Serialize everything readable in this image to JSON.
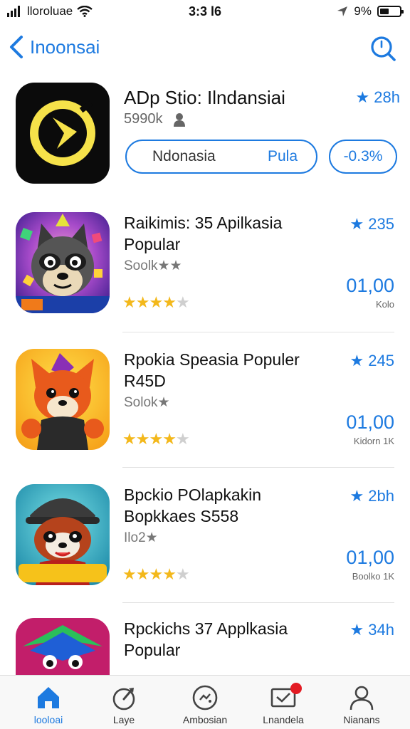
{
  "status_bar": {
    "carrier": "lloroluae",
    "time": "3:3 l6",
    "battery_text": "9%"
  },
  "nav": {
    "back_label": "Inoonsai",
    "search_icon": "search-icon"
  },
  "featured": {
    "title": "ADp Stio: Ilndansiai",
    "subtitle": "5990k",
    "rating": "★ 28h",
    "pill_left": "Ndonasia",
    "pill_right": "Pula",
    "pill_small": "-0.3%"
  },
  "apps": [
    {
      "title": "Raikimis: 35 Apilkasia Popular",
      "developer": "Soolk★★",
      "rank": "★ 235",
      "price": "01,00",
      "size": "Kolo",
      "rating": 4
    },
    {
      "title": "Rpokia Speasia Populer R45D",
      "developer": "Solok★",
      "rank": "★ 245",
      "price": "01,00",
      "size": "Kidorn 1K",
      "rating": 4
    },
    {
      "title": "Bpckio POlapkakin Bopkkaes S558",
      "developer": "Ilo2★",
      "rank": "★ 2bh",
      "price": "01,00",
      "size": "Boolko 1K",
      "rating": 4
    },
    {
      "title": "Rpckichs 37 Applkasia Popular",
      "developer": "",
      "rank": "★ 34h",
      "price": "",
      "size": "",
      "rating": 0
    }
  ],
  "tabs": [
    {
      "label": "looloai",
      "icon": "home-icon",
      "active": true
    },
    {
      "label": "Laye",
      "icon": "rocket-icon",
      "active": false
    },
    {
      "label": "Ambosian",
      "icon": "arcade-icon",
      "active": false
    },
    {
      "label": "Lnandela",
      "icon": "updates-icon",
      "active": false
    },
    {
      "label": "Nianans",
      "icon": "person-icon",
      "active": false
    }
  ],
  "colors": {
    "accent": "#1d7ae0",
    "star": "#f3b81b",
    "badge": "#e31b23"
  }
}
